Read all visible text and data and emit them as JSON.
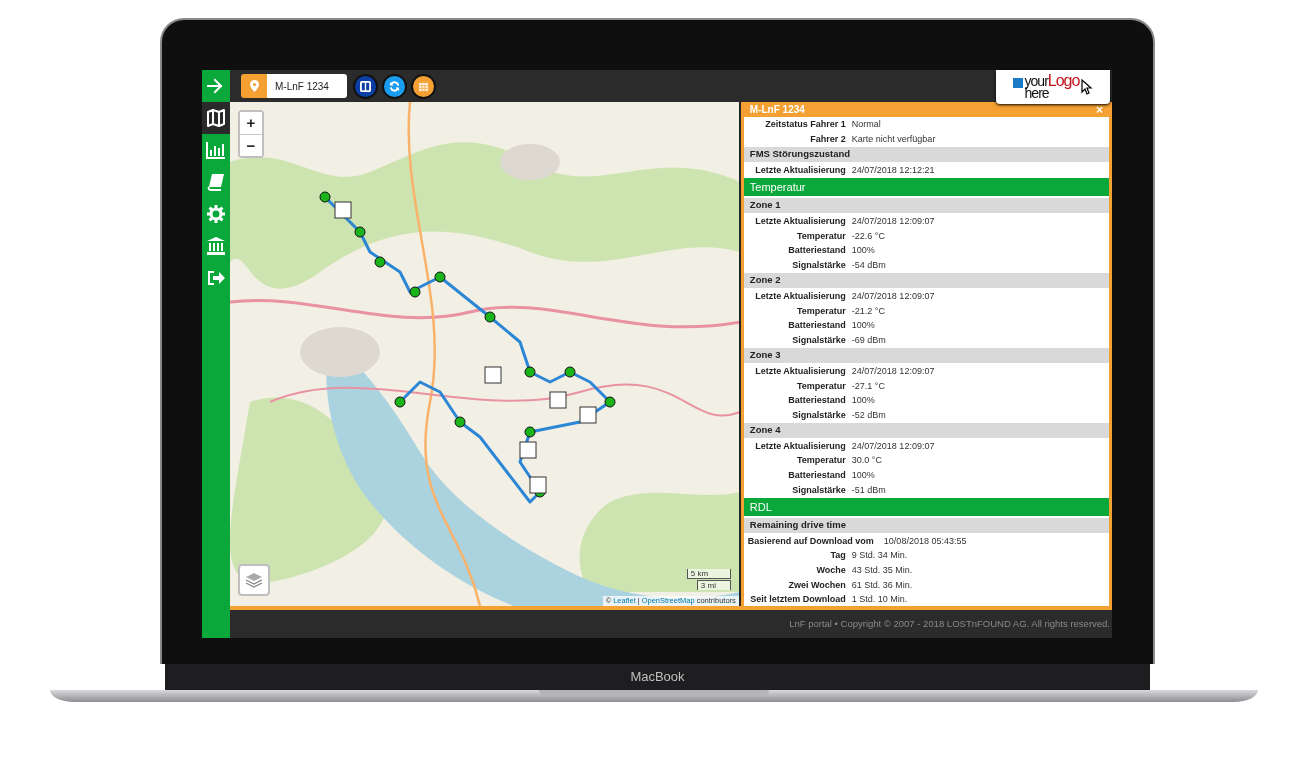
{
  "device": {
    "label": "MacBook"
  },
  "sidebar": {
    "items": [
      {
        "selected": false
      },
      {
        "selected": true
      },
      {
        "selected": false
      },
      {
        "selected": false
      },
      {
        "selected": false
      },
      {
        "selected": false
      },
      {
        "selected": false
      }
    ]
  },
  "toolbar": {
    "vehicle": {
      "value": "M-LnF 1234"
    },
    "buttons": [
      {
        "color": "#0b3fa6"
      },
      {
        "color": "#1a9df0"
      },
      {
        "color": "#f5a033"
      }
    ]
  },
  "logo": {
    "first": "your",
    "accent": "Logo",
    "last": "here"
  },
  "map": {
    "zoom": [
      "+",
      "−"
    ],
    "scale": [
      "5 km",
      "3 mi"
    ],
    "attribution": {
      "prefix": "©",
      "links": [
        "Leaflet",
        "OpenStreetMap"
      ],
      "separator": "|",
      "suffix": "contributors"
    }
  },
  "panel": {
    "title": "M-LnF 1234",
    "close": "×",
    "rows": [
      {
        "kind": "row",
        "label": "Zeitstatus Fahrer 1",
        "value": "Normal"
      },
      {
        "kind": "row",
        "label": "Fahrer 2",
        "value": "Karte nicht verfügbar"
      },
      {
        "kind": "subheader",
        "label": "FMS Störungszustand"
      },
      {
        "kind": "row",
        "label": "Letzte Aktualisierung",
        "value": "24/07/2018 12:12:21"
      },
      {
        "kind": "section",
        "label": "Temperatur"
      },
      {
        "kind": "subheader",
        "label": "Zone 1"
      },
      {
        "kind": "row",
        "label": "Letzte Aktualisierung",
        "value": "24/07/2018 12:09:07"
      },
      {
        "kind": "row",
        "label": "Temperatur",
        "value": "-22.6 °C"
      },
      {
        "kind": "row",
        "label": "Batteriestand",
        "value": "100%"
      },
      {
        "kind": "row",
        "label": "Signalstärke",
        "value": "-54 dBm"
      },
      {
        "kind": "subheader",
        "label": "Zone 2"
      },
      {
        "kind": "row",
        "label": "Letzte Aktualisierung",
        "value": "24/07/2018 12:09:07"
      },
      {
        "kind": "row",
        "label": "Temperatur",
        "value": "-21.2 °C"
      },
      {
        "kind": "row",
        "label": "Batteriestand",
        "value": "100%"
      },
      {
        "kind": "row",
        "label": "Signalstärke",
        "value": "-69 dBm"
      },
      {
        "kind": "subheader",
        "label": "Zone 3"
      },
      {
        "kind": "row",
        "label": "Letzte Aktualisierung",
        "value": "24/07/2018 12:09:07"
      },
      {
        "kind": "row",
        "label": "Temperatur",
        "value": "-27.1 °C"
      },
      {
        "kind": "row",
        "label": "Batteriestand",
        "value": "100%"
      },
      {
        "kind": "row",
        "label": "Signalstärke",
        "value": "-52 dBm"
      },
      {
        "kind": "subheader",
        "label": "Zone 4"
      },
      {
        "kind": "row",
        "label": "Letzte Aktualisierung",
        "value": "24/07/2018 12:09:07"
      },
      {
        "kind": "row",
        "label": "Temperatur",
        "value": "30.0 °C"
      },
      {
        "kind": "row",
        "label": "Batteriestand",
        "value": "100%"
      },
      {
        "kind": "row",
        "label": "Signalstärke",
        "value": "-51 dBm"
      },
      {
        "kind": "section",
        "label": "RDL"
      },
      {
        "kind": "subheader",
        "label": "Remaining drive time"
      },
      {
        "kind": "wide",
        "label": "Basierend auf Download vom",
        "value": "10/08/2018 05:43:55"
      },
      {
        "kind": "row",
        "label": "Tag",
        "value": "9 Std. 34 Min."
      },
      {
        "kind": "row",
        "label": "Woche",
        "value": "43 Std. 35 Min."
      },
      {
        "kind": "row",
        "label": "Zwei Wochen",
        "value": "61 Std. 36 Min."
      },
      {
        "kind": "row",
        "label": "Seit letztem Download",
        "value": "1 Std. 10 Min."
      }
    ]
  },
  "footer": {
    "text": "LnF portal • Copyright © 2007 - 2018 LOSTnFOUND AG. All rights reserved."
  }
}
